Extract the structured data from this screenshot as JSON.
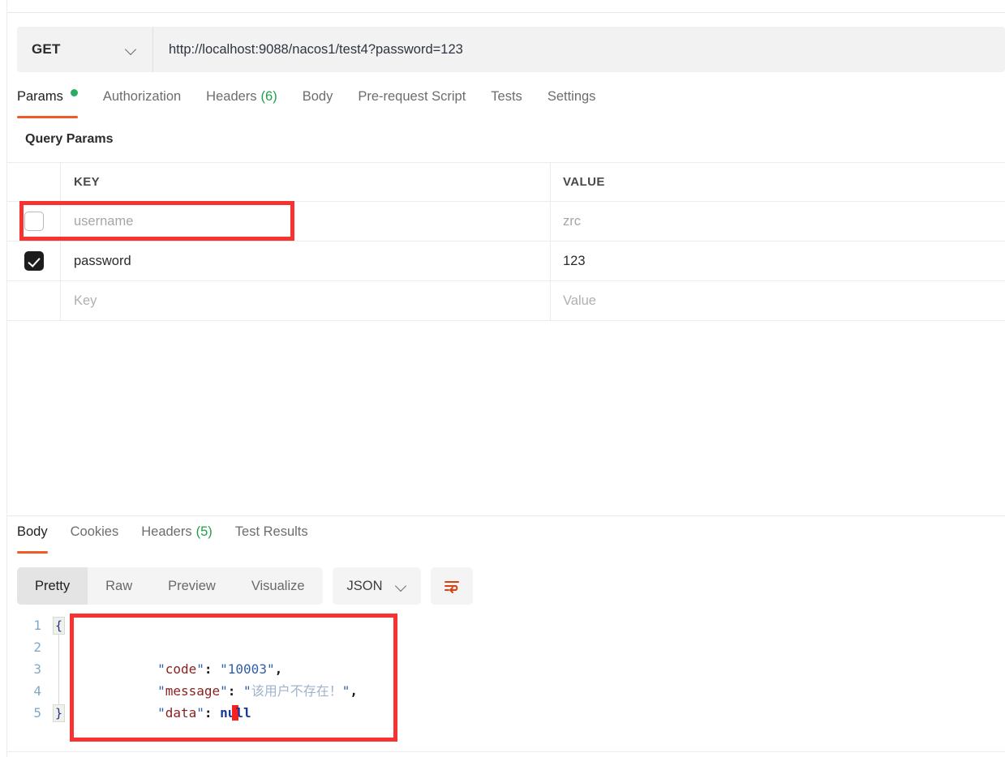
{
  "request": {
    "method": "GET",
    "method_caret_icon": "chevron-down-icon",
    "url": "http://localhost:9088/nacos1/test4?password=123",
    "tabs": [
      {
        "label": "Params",
        "badge": "",
        "dot": true,
        "active": true
      },
      {
        "label": "Authorization",
        "badge": "",
        "dot": false,
        "active": false
      },
      {
        "label": "Headers",
        "badge": "(6)",
        "dot": false,
        "active": false
      },
      {
        "label": "Body",
        "badge": "",
        "dot": false,
        "active": false
      },
      {
        "label": "Pre-request Script",
        "badge": "",
        "dot": false,
        "active": false
      },
      {
        "label": "Tests",
        "badge": "",
        "dot": false,
        "active": false
      },
      {
        "label": "Settings",
        "badge": "",
        "dot": false,
        "active": false
      }
    ],
    "query_params": {
      "section_title": "Query Params",
      "columns": {
        "key": "KEY",
        "value": "VALUE"
      },
      "rows": [
        {
          "checked": false,
          "key": "username",
          "key_is_placeholder": true,
          "value": "zrc",
          "value_is_placeholder": true,
          "annotated": true
        },
        {
          "checked": true,
          "key": "password",
          "key_is_placeholder": false,
          "value": "123",
          "value_is_placeholder": false,
          "annotated": false
        }
      ],
      "new_row": {
        "key_placeholder": "Key",
        "value_placeholder": "Value"
      }
    }
  },
  "response": {
    "tabs": [
      {
        "label": "Body",
        "badge": "",
        "active": true
      },
      {
        "label": "Cookies",
        "badge": "",
        "active": false
      },
      {
        "label": "Headers",
        "badge": "(5)",
        "active": false
      },
      {
        "label": "Test Results",
        "badge": "",
        "active": false
      }
    ],
    "format_bar": {
      "views": [
        {
          "label": "Pretty",
          "active": true
        },
        {
          "label": "Raw",
          "active": false
        },
        {
          "label": "Preview",
          "active": false
        },
        {
          "label": "Visualize",
          "active": false
        }
      ],
      "content_type": "JSON",
      "content_type_caret_icon": "chevron-down-icon",
      "wrap_icon": "word-wrap-icon"
    },
    "body_editor": {
      "line_numbers": [
        "1",
        "2",
        "3",
        "4",
        "5"
      ],
      "fold_open": "{",
      "fold_close": "}",
      "lines": [
        {
          "n": "1",
          "type": "brace_open",
          "text": "{"
        },
        {
          "n": "2",
          "type": "pair",
          "key": "code",
          "value": "10003",
          "value_kind": "string",
          "comma": ","
        },
        {
          "n": "3",
          "type": "pair",
          "key": "message",
          "value": "该用户不存在！",
          "value_kind": "cjk-string",
          "comma": ","
        },
        {
          "n": "4",
          "type": "pair",
          "key": "data",
          "value": "null",
          "value_kind": "null",
          "comma": ""
        },
        {
          "n": "5",
          "type": "brace_close",
          "text": "}"
        }
      ],
      "raw_json": "{\n    \"code\": \"10003\",\n    \"message\": \"该用户不存在！\",\n    \"data\": null\n}"
    }
  },
  "annotations": [
    {
      "name": "username-row-highlight",
      "color": "#fa3131"
    },
    {
      "name": "response-body-highlight",
      "color": "#fa3131"
    }
  ],
  "colors": {
    "accent_orange": "#ef5b25",
    "dot_green": "#27ae60",
    "count_green": "#20a04c",
    "annotation_red": "#fa3131",
    "json_key": "#8a1f1f",
    "json_string": "#2d5fa8",
    "json_null": "#17379c",
    "gutter": "#7fa9c8"
  }
}
